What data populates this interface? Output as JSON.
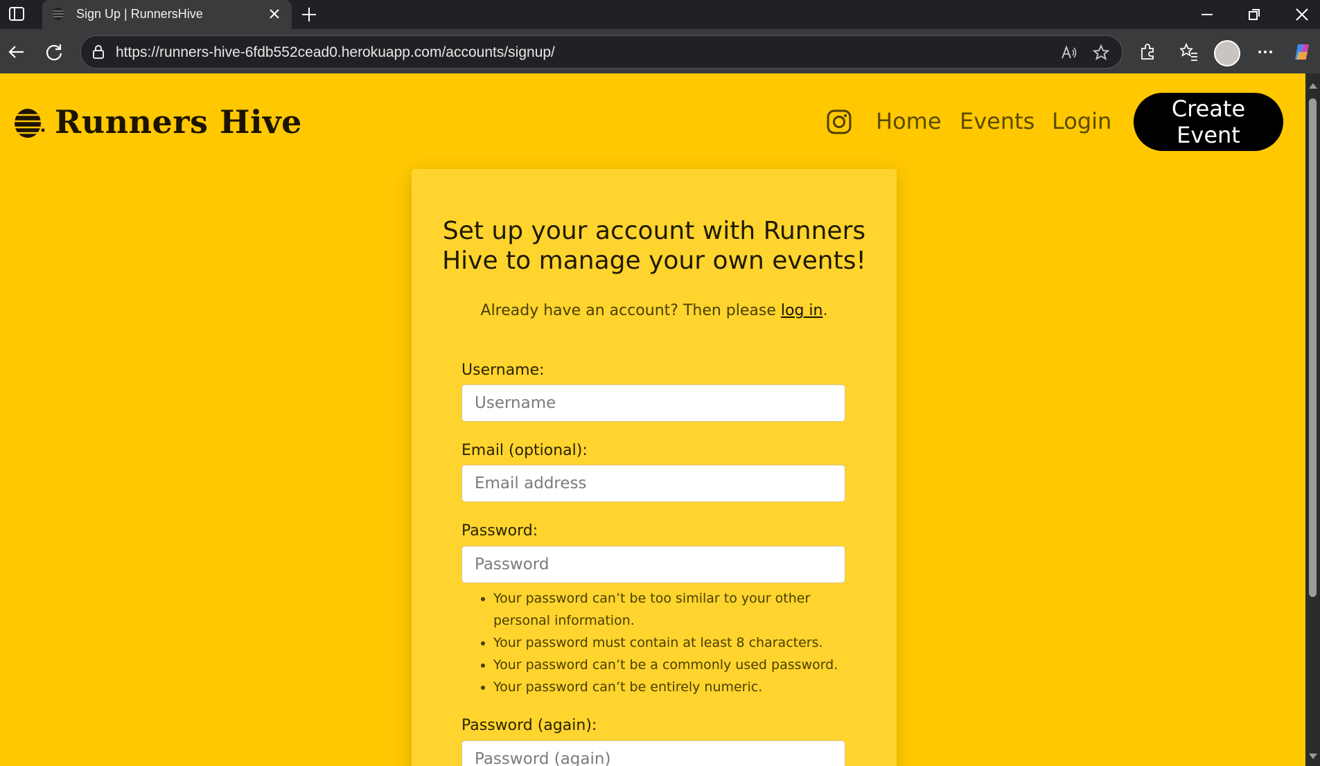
{
  "browser": {
    "tab_title": "Sign Up | RunnersHive",
    "url": "https://runners-hive-6fdb552cead0.herokuapp.com/accounts/signup/"
  },
  "site": {
    "brand": "Runners Hive",
    "nav": {
      "home": "Home",
      "events": "Events",
      "login": "Login",
      "create_event": "Create Event"
    }
  },
  "signup": {
    "heading": "Set up your account with Runners Hive to manage your own events!",
    "prompt_prefix": "Already have an account? Then please ",
    "prompt_link": "log in",
    "prompt_suffix": ".",
    "username_label": "Username:",
    "username_placeholder": "Username",
    "email_label": "Email (optional):",
    "email_placeholder": "Email address",
    "password_label": "Password:",
    "password_placeholder": "Password",
    "password_help": [
      "Your password can’t be too similar to your other personal information.",
      "Your password must contain at least 8 characters.",
      "Your password can’t be a commonly used password.",
      "Your password can’t be entirely numeric."
    ],
    "password2_label": "Password (again):",
    "password2_placeholder": "Password (again)"
  },
  "colors": {
    "page_background": "#ffc800",
    "card_background": "#ffd42e",
    "button_background": "#000000"
  }
}
